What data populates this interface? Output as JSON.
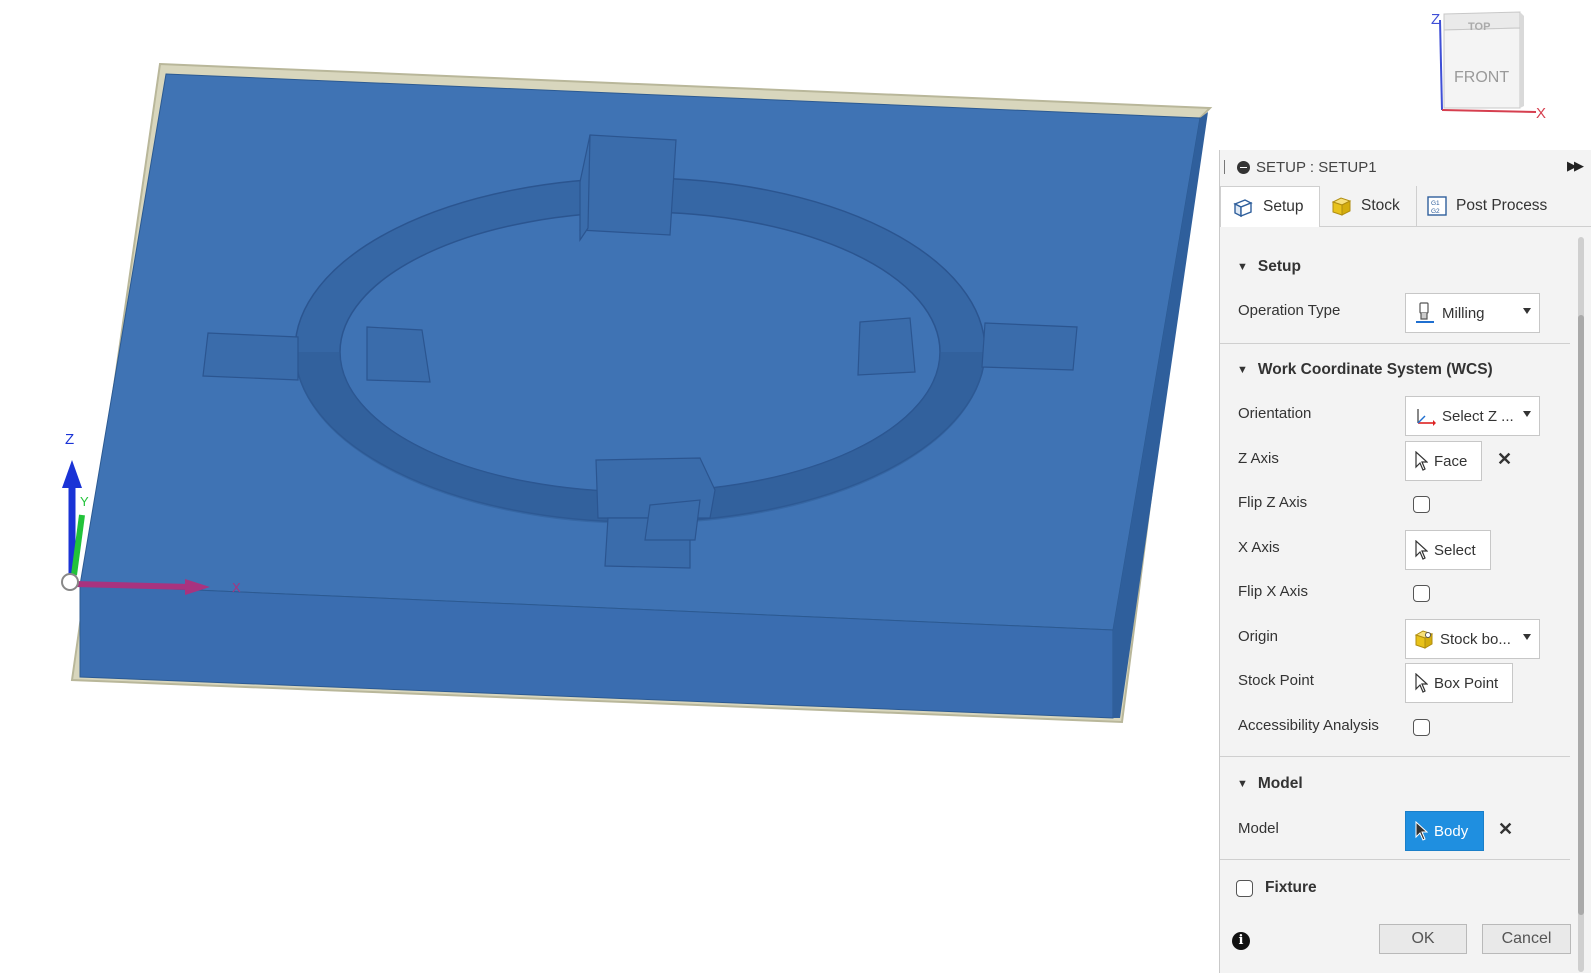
{
  "viewcube": {
    "top_label": "TOP",
    "front_label": "FRONT",
    "z_label": "Z",
    "x_label": "X"
  },
  "triad": {
    "z_label": "Z",
    "y_label": "Y",
    "x_label": "X"
  },
  "colors": {
    "model": "#3a6fb0",
    "accent": "#1f8fe0",
    "panel_bg": "#f3f3f3"
  },
  "panel": {
    "title": "SETUP : SETUP1",
    "expand_icon": "double-chevron-right-icon",
    "tabs": [
      {
        "label": "Setup",
        "icon": "setup-icon",
        "active": true
      },
      {
        "label": "Stock",
        "icon": "stock-box-icon",
        "active": false
      },
      {
        "label": "Post Process",
        "icon": "g1g2-icon",
        "active": false
      }
    ],
    "sections": {
      "setup": {
        "title": "Setup",
        "operation_type_label": "Operation Type",
        "operation_type_value": "Milling"
      },
      "wcs": {
        "title": "Work Coordinate System (WCS)",
        "orientation_label": "Orientation",
        "orientation_value": "Select Z ...",
        "z_axis_label": "Z Axis",
        "z_axis_value": "Face",
        "flip_z_label": "Flip Z Axis",
        "x_axis_label": "X Axis",
        "x_axis_value": "Select",
        "flip_x_label": "Flip X Axis",
        "origin_label": "Origin",
        "origin_value": "Stock bo...",
        "stock_point_label": "Stock Point",
        "stock_point_value": "Box Point",
        "accessibility_label": "Accessibility Analysis"
      },
      "model": {
        "title": "Model",
        "model_label": "Model",
        "model_value": "Body"
      },
      "fixture": {
        "title": "Fixture"
      }
    },
    "footer": {
      "info": "i",
      "ok": "OK",
      "cancel": "Cancel"
    }
  }
}
